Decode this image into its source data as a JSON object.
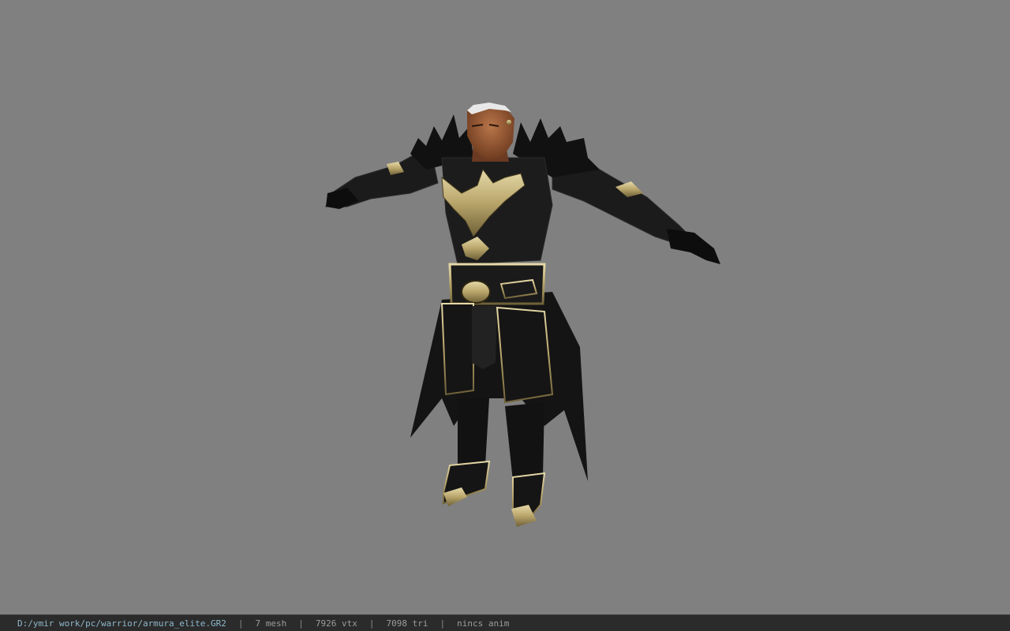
{
  "viewer": {
    "background_color": "#808080",
    "model_name": "armura_elite",
    "model_icon": "warrior-armor-model"
  },
  "status": {
    "file_path": "D:/ymir work/pc/warrior/armura_elite.GR2",
    "mesh_count": "7 mesh",
    "vertex_count": "7926 vtx",
    "triangle_count": "7098 tri",
    "animation_info": "nincs anim",
    "separator": "|"
  }
}
